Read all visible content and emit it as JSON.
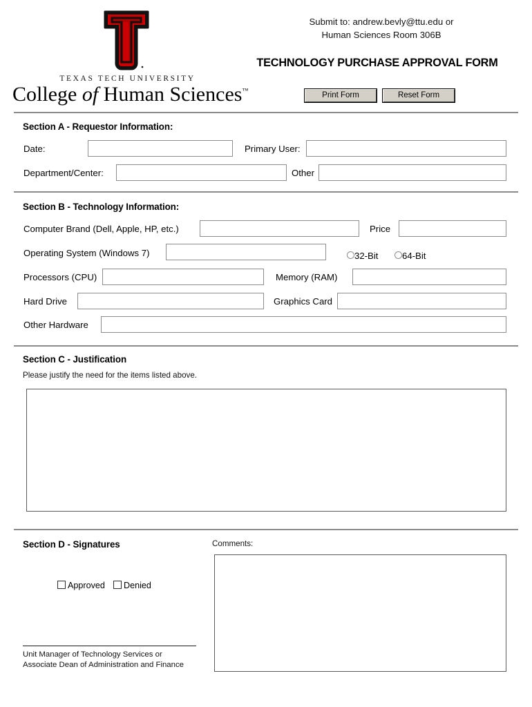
{
  "header": {
    "logo": {
      "mark_name": "texas-tech-double-t-logo",
      "university": "TEXAS TECH UNIVERSITY",
      "college_pre": "College",
      "college_of": "of",
      "college_post": "Human Sciences",
      "trademark": "™",
      "red": "#cc0000",
      "black": "#111111"
    },
    "submit_line1": "Submit to: andrew.bevly@ttu.edu or",
    "submit_line2": "Human Sciences Room 306B",
    "title": "TECHNOLOGY PURCHASE APPROVAL FORM",
    "print_button": "Print Form",
    "reset_button": "Reset Form"
  },
  "section_a": {
    "heading": "Section A - Requestor Information:",
    "date_label": "Date:",
    "date_value": "",
    "date_placeholder": "",
    "primary_user_label": "Primary User:",
    "primary_user_value": "",
    "primary_user_placeholder": "",
    "department_label": "Department/Center:",
    "department_value": "",
    "department_placeholder": "",
    "other_label": "Other",
    "other_value": "",
    "other_placeholder": ""
  },
  "section_b": {
    "heading": "Section B - Technology Information:",
    "brand_label": "Computer Brand (Dell, Apple, HP, etc.)",
    "brand_value": "",
    "price_label": "Price",
    "price_value": "",
    "os_label": "Operating System (Windows 7)",
    "os_value": "",
    "bit32_label": "32-Bit",
    "bit64_label": "64-Bit",
    "cpu_label": "Processors (CPU)",
    "cpu_value": "",
    "ram_label": "Memory (RAM)",
    "ram_value": "",
    "hdd_label": "Hard Drive",
    "hdd_value": "",
    "gpu_label": "Graphics Card",
    "gpu_value": "",
    "other_hw_label": "Other Hardware",
    "other_hw_value": ""
  },
  "section_c": {
    "heading": "Section C - Justification",
    "subheading": "Please justify the need for the items listed above.",
    "justification_value": ""
  },
  "section_d": {
    "heading": "Section D - Signatures",
    "comments_label": "Comments:",
    "comments_value": "",
    "approved_label": "Approved",
    "denied_label": "Denied",
    "signature_caption_line1": "Unit Manager of Technology Services or",
    "signature_caption_line2": "Associate Dean of Administration and Finance"
  }
}
